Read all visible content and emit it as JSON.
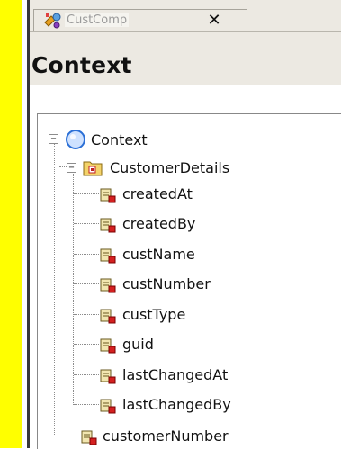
{
  "tab": {
    "title": "CustComp",
    "close_label": "✕",
    "icon": "component-icon"
  },
  "view": {
    "title": "Context"
  },
  "tree": {
    "root": {
      "label": "Context",
      "icon": "context-node-icon",
      "expanded": true
    },
    "node": {
      "label": "CustomerDetails",
      "icon": "node-folder-icon",
      "expanded": true
    },
    "attributes": [
      {
        "label": "createdAt"
      },
      {
        "label": "createdBy"
      },
      {
        "label": "custName"
      },
      {
        "label": "custNumber"
      },
      {
        "label": "custType"
      },
      {
        "label": "guid"
      },
      {
        "label": "lastChangedAt"
      },
      {
        "label": "lastChangedBy"
      }
    ],
    "root_attribute": {
      "label": "customerNumber"
    }
  },
  "colors": {
    "left_strip": "#ffff00",
    "chrome": "#ece9e2",
    "root_circle": "#2b6fd6"
  }
}
